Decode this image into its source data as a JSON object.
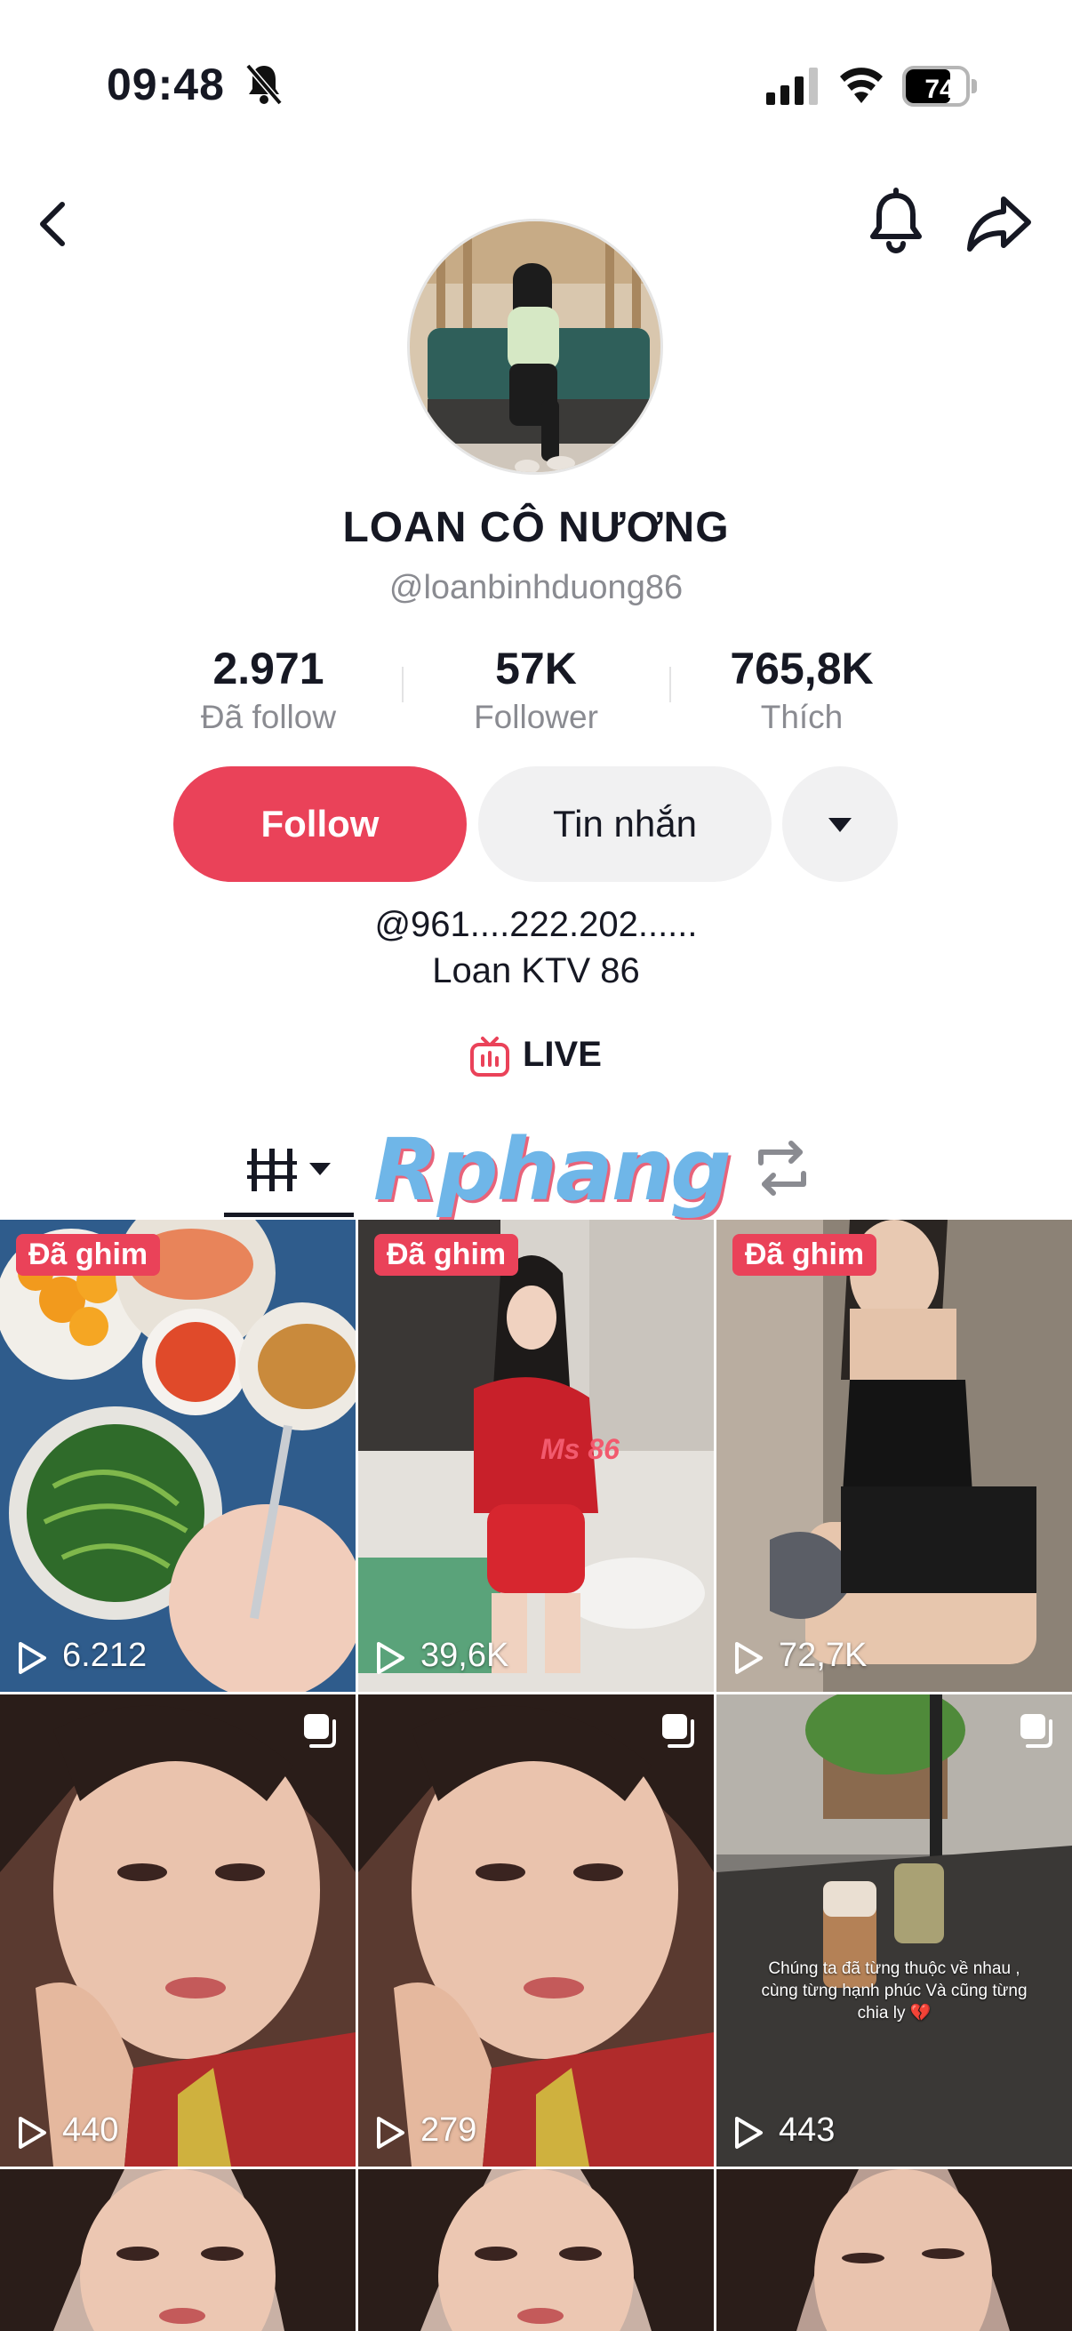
{
  "status_bar": {
    "time": "09:48",
    "battery_percent": "74",
    "battery_level": 0.74
  },
  "profile": {
    "name": "LOAN CÔ NƯƠNG",
    "handle": "@loanbinhduong86"
  },
  "stats": [
    {
      "value": "2.971",
      "label": "Đã follow"
    },
    {
      "value": "57K",
      "label": "Follower"
    },
    {
      "value": "765,8K",
      "label": "Thích"
    }
  ],
  "actions": {
    "follow_label": "Follow",
    "message_label": "Tin nhắn"
  },
  "bio": {
    "line1": "@961....222.202......",
    "line2": "Loan KTV 86"
  },
  "live": {
    "label": "LIVE"
  },
  "watermark": {
    "text": "Rphang"
  },
  "videos": [
    {
      "pinned": true,
      "pin_label": "Đã ghim",
      "views": "6.212"
    },
    {
      "pinned": true,
      "pin_label": "Đã ghim",
      "views": "39,6K",
      "overlay_text": "Ms 86"
    },
    {
      "pinned": true,
      "pin_label": "Đã ghim",
      "views": "72,7K"
    },
    {
      "pinned": false,
      "views": "440",
      "multi": true
    },
    {
      "pinned": false,
      "views": "279",
      "multi": true
    },
    {
      "pinned": false,
      "views": "443",
      "multi": true,
      "caption": "Chúng ta đã từng thuộc về nhau , cùng từng hạnh phúc Và cũng từng chia ly 💔"
    }
  ],
  "colors": {
    "accent": "#ea4259",
    "secondary_button": "#f1f1f2",
    "muted_text": "#8a8b91"
  }
}
